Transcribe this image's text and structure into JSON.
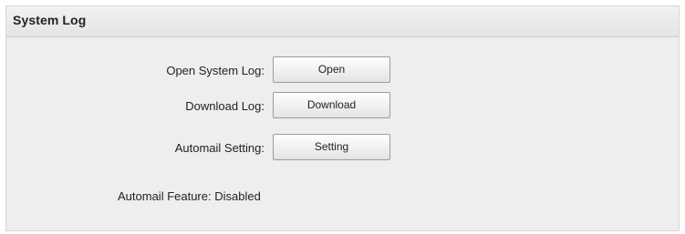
{
  "panel": {
    "title": "System Log"
  },
  "rows": [
    {
      "label": "Open System Log:",
      "button": "Open"
    },
    {
      "label": "Download Log:",
      "button": "Download"
    },
    {
      "label": "Automail Setting:",
      "button": "Setting"
    }
  ],
  "status": {
    "label": "Automail Feature:",
    "value": "Disabled"
  }
}
